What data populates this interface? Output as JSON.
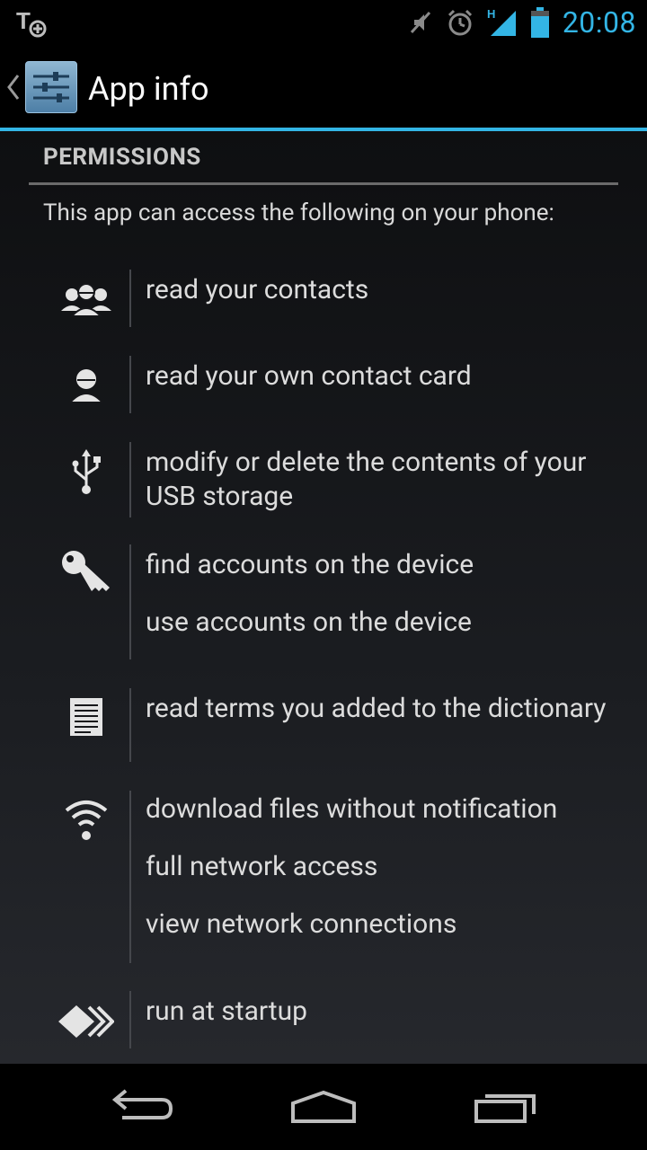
{
  "status_bar": {
    "time": "20:08",
    "network_type": "H",
    "icons": [
      "t-plus-icon",
      "mute-icon",
      "alarm-icon",
      "signal-icon",
      "battery-icon"
    ],
    "accent_color": "#33b5e5"
  },
  "action_bar": {
    "title": "App info"
  },
  "permissions": {
    "header": "PERMISSIONS",
    "intro": "This app can access the following on your phone:",
    "groups": [
      {
        "icon": "contacts-icon",
        "items": [
          "read your contacts"
        ]
      },
      {
        "icon": "contact-card-icon",
        "items": [
          "read your own contact card"
        ]
      },
      {
        "icon": "usb-icon",
        "items": [
          "modify or delete the contents of your USB storage"
        ]
      },
      {
        "icon": "key-icon",
        "items": [
          "find accounts on the device",
          "use accounts on the device"
        ]
      },
      {
        "icon": "dictionary-icon",
        "items": [
          "read terms you added to the dictionary"
        ]
      },
      {
        "icon": "wifi-icon",
        "items": [
          "download files without notification",
          "full network access",
          "view network connections"
        ]
      },
      {
        "icon": "startup-icon",
        "items": [
          "run at startup"
        ]
      }
    ]
  },
  "nav_bar": {
    "buttons": [
      "back-icon",
      "home-icon",
      "recent-apps-icon"
    ]
  }
}
